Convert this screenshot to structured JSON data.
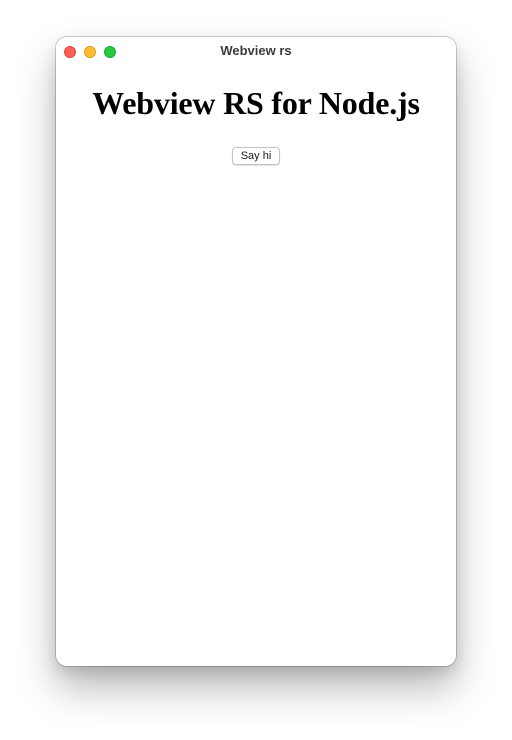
{
  "window": {
    "title": "Webview rs",
    "controls": {
      "close_icon": "close-traffic-light",
      "minimize_icon": "minimize-traffic-light",
      "zoom_icon": "zoom-traffic-light"
    }
  },
  "page": {
    "heading": "Webview RS for Node.js",
    "button_label": "Say hi"
  },
  "colors": {
    "close": "#fe5f57",
    "minimize": "#febc2e",
    "zoom": "#28c840",
    "background": "#ffffff"
  }
}
